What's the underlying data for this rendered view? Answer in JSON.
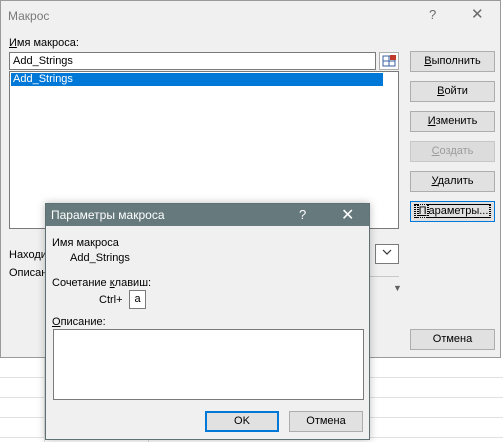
{
  "macro_dialog": {
    "title": "Макрос",
    "help_glyph": "?",
    "close_glyph": "✕",
    "name_label_pre": "",
    "name_label_u": "И",
    "name_label_post": "мя макроса:",
    "name_value": "Add_Strings",
    "list_items": [
      "Add_Strings"
    ],
    "location_label": "Находи",
    "description_label": "Описан",
    "buttons": {
      "run": {
        "pre": "",
        "u": "В",
        "post": "ыполнить"
      },
      "step": {
        "pre": "",
        "u": "В",
        "post": "ойти"
      },
      "edit": {
        "pre": "",
        "u": "И",
        "post": "зменить"
      },
      "create": {
        "pre": "",
        "u": "С",
        "post": "оздать"
      },
      "delete": {
        "pre": "",
        "u": "У",
        "post": "далить"
      },
      "options": {
        "pre": "",
        "u": "П",
        "post": "араметры..."
      },
      "cancel": "Отмена"
    }
  },
  "options_dialog": {
    "title": "Параметры макроса",
    "help_glyph": "?",
    "close_glyph": "✕",
    "macro_name_label": "Имя макроса",
    "macro_name_value": "Add_Strings",
    "shortcut_label_pre": "Сочетание ",
    "shortcut_label_u": "к",
    "shortcut_label_post": "лавиш:",
    "shortcut_prefix": "Ctrl+",
    "shortcut_key": "a",
    "description_label_u": "О",
    "description_label_post": "писание:",
    "description_value": "",
    "ok_label": "OK",
    "cancel_label": "Отмена"
  },
  "icons": {
    "ref_icon": "range-select-icon",
    "dropdown_icon": "chevron-down-icon",
    "scroll_icon": "scroll-down-arrow-icon"
  },
  "colors": {
    "selection": "#0078d7",
    "options_titlebar": "#667a7d",
    "focus_border": "#0078d7"
  }
}
